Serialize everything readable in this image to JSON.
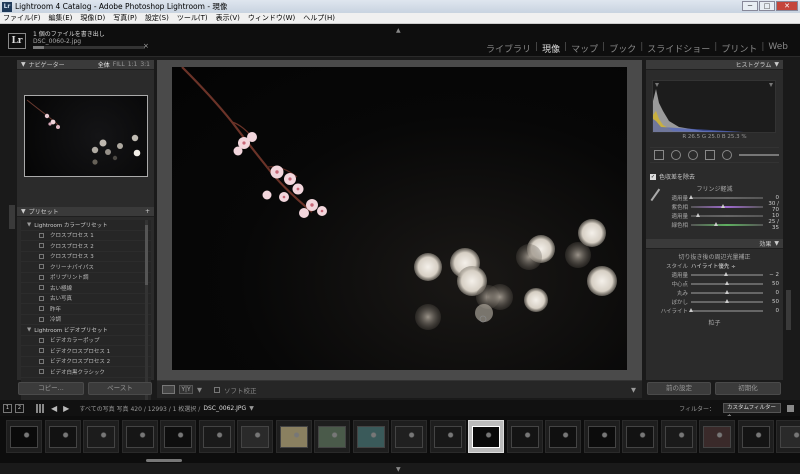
{
  "window": {
    "title": "Lightroom 4 Catalog - Adobe Photoshop Lightroom - 現像",
    "icon_text": "Lr",
    "buttons": {
      "minimize": "─",
      "maximize": "□",
      "close": "✕"
    }
  },
  "menu": [
    "ファイル(F)",
    "編集(E)",
    "現像(D)",
    "写真(P)",
    "設定(S)",
    "ツール(T)",
    "表示(V)",
    "ウィンドウ(W)",
    "ヘルプ(H)"
  ],
  "identity": {
    "logo": "Lr",
    "activity_title": "1 個のファイルを書き出し",
    "activity_sub": "DSC_0060-2.jpg",
    "progress_fraction": 0.1,
    "cancel": "×"
  },
  "modules": {
    "items": [
      "ライブラリ",
      "現像",
      "マップ",
      "ブック",
      "スライドショー",
      "プリント",
      "Web"
    ],
    "active": "現像"
  },
  "left": {
    "navigator": {
      "title": "ナビゲーター",
      "zoom_options": [
        "全体",
        "FILL",
        "1:1",
        "3:1"
      ]
    },
    "presets": {
      "title": "プリセット",
      "add": "+",
      "rows": [
        {
          "type": "folder",
          "label": "Lightroom カラープリセット"
        },
        {
          "type": "item",
          "label": "クロスプロセス 1"
        },
        {
          "type": "item",
          "label": "クロスプロセス 2"
        },
        {
          "type": "item",
          "label": "クロスプロセス 3"
        },
        {
          "type": "item",
          "label": "クリーナパイパス"
        },
        {
          "type": "item",
          "label": "ポリプリント調"
        },
        {
          "type": "item",
          "label": "古い極線"
        },
        {
          "type": "item",
          "label": "古い写真"
        },
        {
          "type": "item",
          "label": "昨年"
        },
        {
          "type": "item",
          "label": "冷調"
        },
        {
          "type": "folder",
          "label": "Lightroom ビデオプリセット"
        },
        {
          "type": "item",
          "label": "ビデオカラーポップ"
        },
        {
          "type": "item",
          "label": "ビデオクロスプロセス 1"
        },
        {
          "type": "item",
          "label": "ビデオクロスプロセス 2"
        },
        {
          "type": "item",
          "label": "ビデオ白黒クラシック"
        }
      ]
    },
    "copy_button": "コピー...",
    "paste_button": "ペースト"
  },
  "toolbar": {
    "soft_proof": "ソフト校正",
    "view_ab": "Y|Y",
    "dropdown": "▼"
  },
  "right": {
    "histogram": {
      "title": "ヒストグラム",
      "readout": "R  26.5   G  25.0   B  25.3 %"
    },
    "lens": {
      "remove_ca_label": "色収差を除去",
      "remove_ca_checked": "✓",
      "fringe_title": "フリンジ軽減",
      "rows": [
        {
          "label": "適用量",
          "value": "0",
          "pos": 0.0,
          "color": "#666"
        },
        {
          "label": "紫色相",
          "value": "30 / 70",
          "pos": 0.45,
          "color": "#a06ad0"
        },
        {
          "label": "適用量",
          "value": "10",
          "pos": 0.1,
          "color": "#666"
        },
        {
          "label": "緑色相",
          "value": "25 / 35",
          "pos": 0.35,
          "color": "#5fb060"
        }
      ]
    },
    "effects": {
      "title": "効果",
      "vignette_title": "切り抜き後の周辺光量補正",
      "style_label": "スタイル",
      "style_value": "ハイライト優先 ÷",
      "rows": [
        {
          "label": "適用量",
          "value": "− 2",
          "pos": 0.48
        },
        {
          "label": "中心点",
          "value": "50",
          "pos": 0.5
        },
        {
          "label": "丸み",
          "value": "0",
          "pos": 0.5
        },
        {
          "label": "ぼかし",
          "value": "50",
          "pos": 0.5
        },
        {
          "label": "ハイライト",
          "value": "0",
          "pos": 0.0
        }
      ],
      "grain_title": "粒子"
    },
    "prev_button": "前の設定",
    "reset_button": "初期化"
  },
  "filmbar": {
    "screen1": "1",
    "screen2": "2",
    "crumb": "すべての写真   写真 420 / 12993 / 1 枚選択 /",
    "filename": "DSC_0062.JPG",
    "filename_dd": "▼",
    "filter_label": "フィルター：",
    "filter_value": "カスタムフィルター ÷"
  },
  "filmstrip": {
    "selected_index": 12,
    "count": 21
  },
  "colors": {
    "background": "#1a1a1a",
    "panel": "#2b2b2b",
    "accent": "#dddddd",
    "hist_yellow": "#c9b040",
    "hist_blue": "#4a60c0"
  }
}
